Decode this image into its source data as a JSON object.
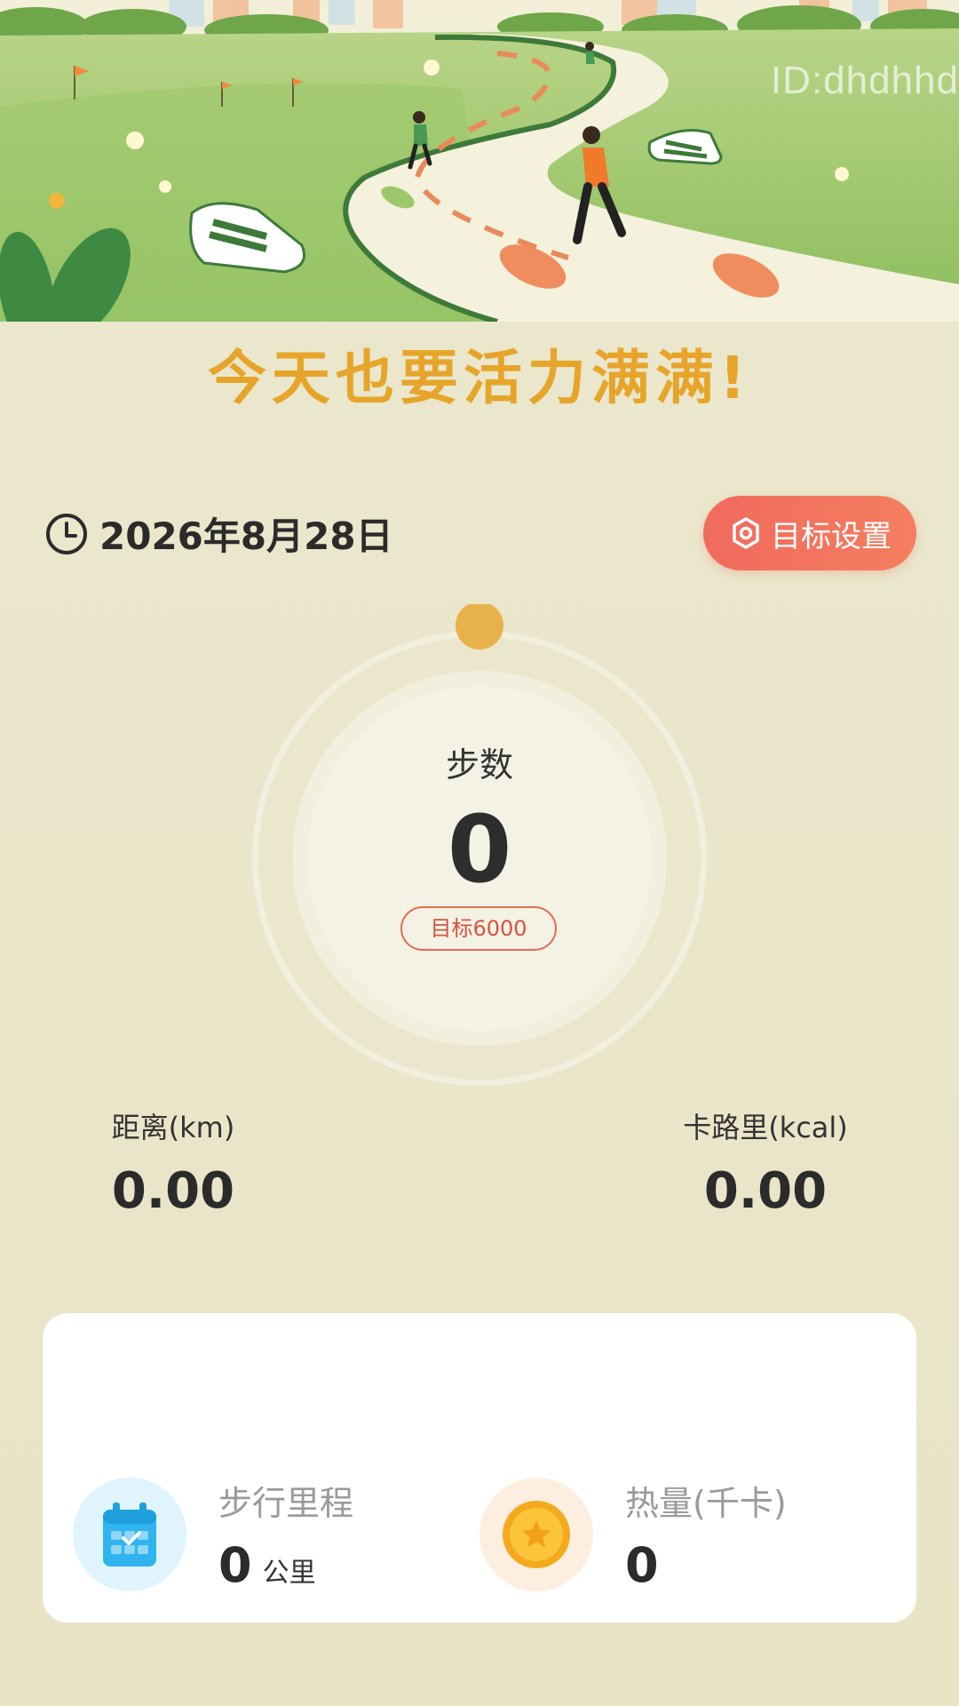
{
  "banner": {
    "watermark": "ID:dhdhhd"
  },
  "headline": "今天也要活力满满!",
  "date": "2026年8月28日",
  "goal_button": {
    "label": "目标设置"
  },
  "ring": {
    "label": "步数",
    "value": "0",
    "target_label": "目标6000",
    "progress": 0
  },
  "stats": {
    "distance_label": "距离(km)",
    "distance_value": "0.00",
    "calorie_label": "卡路里(kcal)",
    "calorie_value": "0.00"
  },
  "card": {
    "walk_title": "步行里程",
    "walk_value": "0",
    "walk_unit": "公里",
    "heat_title": "热量(千卡)",
    "heat_value": "0"
  },
  "colors": {
    "background": "#ebe6c7",
    "headline": "#e6a52a",
    "goal_button": "#f16a5e",
    "ring_knob": "#e8b24a"
  },
  "icons": {
    "clock": "clock-icon",
    "gear": "gear-icon",
    "calendar": "calendar-icon",
    "coin": "star-coin-icon"
  }
}
